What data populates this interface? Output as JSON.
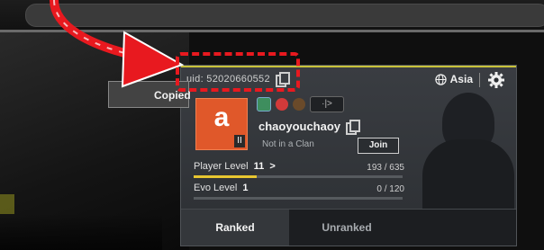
{
  "profile": {
    "uid_text": "uid: 52020660552",
    "region": "Asia",
    "avatar_letter": "a",
    "avatar_badge": "II",
    "player_name": "chaoyouchaoy",
    "clan_status": "Not in a Clan",
    "join_label": "Join",
    "badge_tag": "·|>"
  },
  "levels": {
    "player": {
      "label": "Player Level",
      "value": "11",
      "arrow": ">",
      "progress_text": "193 / 635",
      "progress": 0.3
    },
    "evo": {
      "label": "Evo Level",
      "value": "1",
      "progress_text": "0 / 120",
      "progress": 0.0
    }
  },
  "tabs": [
    {
      "label": "Ranked",
      "active": true
    },
    {
      "label": "Unranked",
      "active": false
    }
  ],
  "toast": {
    "text": "Copied"
  },
  "colors": {
    "accent_yellow": "#e8c630",
    "annotation_red": "#e8191f",
    "avatar_orange": "#e0582a"
  },
  "icons": {
    "copy": "copy-icon",
    "globe": "globe-icon",
    "gear": "gear-icon",
    "arrow": "red-arrow-annotation"
  }
}
